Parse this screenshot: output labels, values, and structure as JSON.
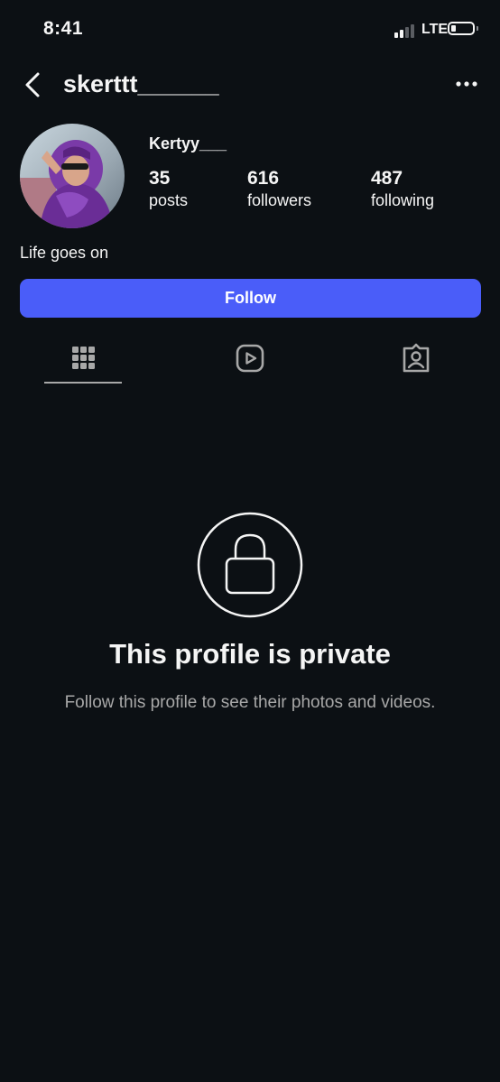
{
  "status_bar": {
    "time": "8:41",
    "network": "LTE",
    "signal_bars_active": 2,
    "signal_bars_total": 4,
    "battery_level_percent": 15
  },
  "header": {
    "username": "skerttt______",
    "back_icon": "chevron-left-icon",
    "more_icon": "ellipsis-icon"
  },
  "profile": {
    "display_name": "Kertyy___",
    "stats": [
      {
        "value": "35",
        "label": "posts"
      },
      {
        "value": "616",
        "label": "followers"
      },
      {
        "value": "487",
        "label": "following"
      }
    ],
    "bio": "Life goes on"
  },
  "actions": {
    "follow_label": "Follow",
    "follow_color": "#4a5df9"
  },
  "tabs": [
    {
      "icon": "grid-icon",
      "active": true
    },
    {
      "icon": "reels-icon",
      "active": false
    },
    {
      "icon": "tagged-icon",
      "active": false
    }
  ],
  "private_notice": {
    "icon": "lock-icon",
    "title": "This profile is private",
    "subtitle": "Follow this profile to see their photos and videos."
  },
  "colors": {
    "background": "#0c1014",
    "text": "#f5f5f5",
    "muted": "#a8a8a8"
  }
}
